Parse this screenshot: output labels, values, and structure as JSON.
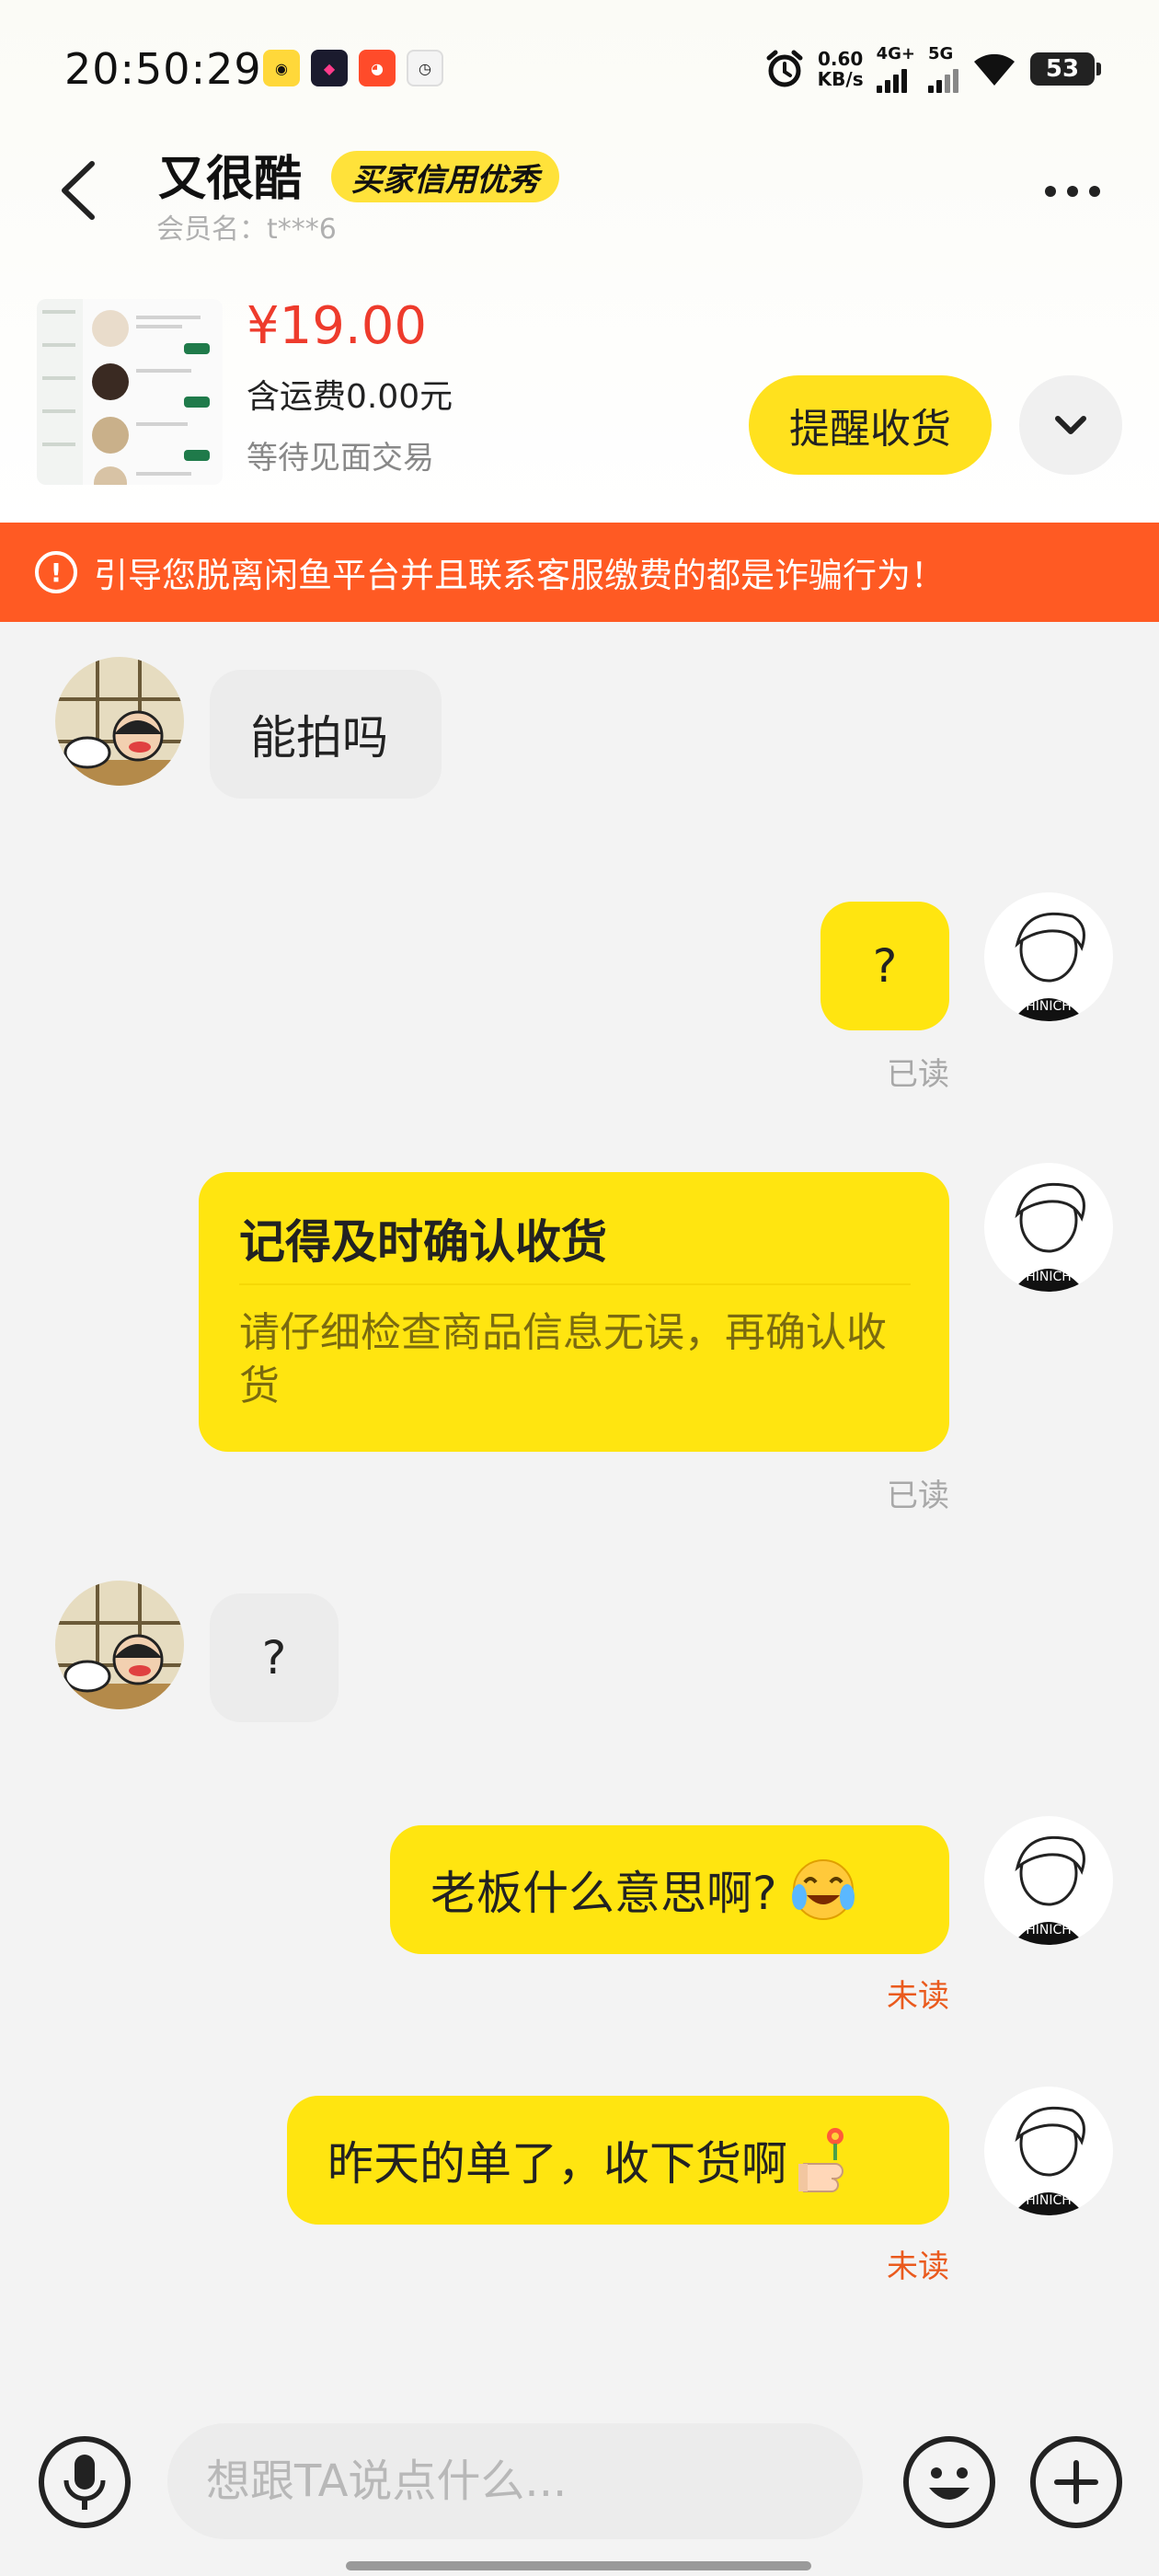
{
  "status_bar": {
    "time": "20:50:29",
    "net_speed_value": "0.60",
    "net_speed_unit": "KB/s",
    "signal1_label": "4G+",
    "signal2_label": "5G",
    "battery": "53"
  },
  "header": {
    "nickname": "又很酷",
    "credit_badge": "买家信用优秀",
    "member_name": "会员名：t***6"
  },
  "product": {
    "price": "¥19.00",
    "shipping": "含运费0.00元",
    "status": "等待见面交易",
    "remind_button": "提醒收货"
  },
  "warning": {
    "text": "引导您脱离闲鱼平台并且联系客服缴费的都是诈骗行为！"
  },
  "messages": [
    {
      "side": "left",
      "text": "能拍吗"
    },
    {
      "side": "right",
      "text": "?",
      "status": "已读"
    },
    {
      "side": "right",
      "type": "card",
      "title": "记得及时确认收货",
      "body": "请仔细检查商品信息无误，再确认收货",
      "status": "已读"
    },
    {
      "side": "left",
      "text": "?"
    },
    {
      "side": "right",
      "text": "老板什么意思啊?",
      "emoji": "crying-laughing",
      "status": "未读"
    },
    {
      "side": "right",
      "text": "昨天的单了，收下货啊",
      "emoji": "thumbs-up-flower",
      "status": "未读"
    }
  ],
  "composer": {
    "placeholder": "想跟TA说点什么..."
  },
  "colors": {
    "accent_yellow": "#ffe510",
    "warning_orange": "#ff5a23",
    "price_red": "#ee3b2c",
    "unread_orange": "#ea5a1d"
  },
  "icons": [
    "back-arrow-icon",
    "more-dots-icon",
    "chevron-down-icon",
    "warning-circle-icon",
    "microphone-icon",
    "emoji-icon",
    "plus-icon",
    "alarm-icon",
    "wifi-icon"
  ]
}
